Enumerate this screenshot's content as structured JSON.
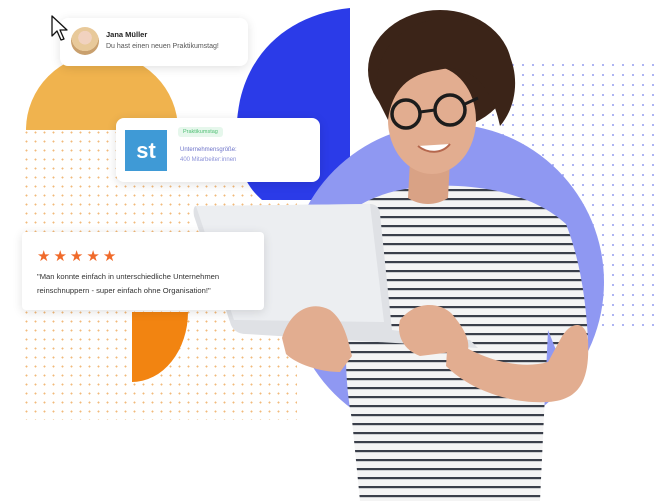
{
  "colors": {
    "yellow": "#f0b34e",
    "blue": "#2b3be8",
    "lavender": "#8f98f2",
    "orange": "#f28411",
    "star": "#f06a2a",
    "logo_bg": "#3f9ad6",
    "badge_bg": "#e6f7ec",
    "badge_text": "#4fbf74",
    "info_text": "#6e74c9"
  },
  "notification": {
    "name": "Jana Müller",
    "message": "Du hast einen neuen Praktikumstag!"
  },
  "company_card": {
    "logo_text": "st",
    "badge": "Praktikumstag",
    "size_label": "Unternehmensgröße:",
    "size_value": "400 Mitarbeiter:innen"
  },
  "review": {
    "rating": 5,
    "quote": "\"Man konnte einfach in unterschiedliche Unternehmen reinschnuppern - super einfach ohne Organisation!\""
  }
}
